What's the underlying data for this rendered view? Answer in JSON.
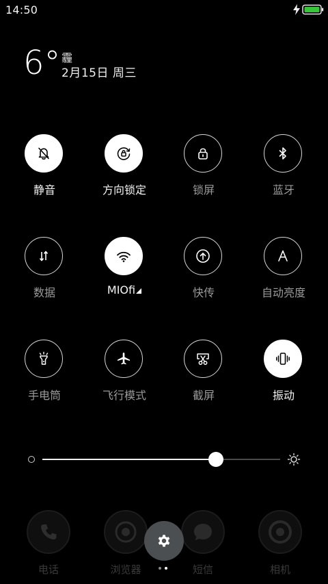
{
  "status_bar": {
    "time": "14:50",
    "icons": [
      "charging-icon",
      "battery-icon"
    ],
    "battery_color": "#39c63b"
  },
  "weather": {
    "temperature": "6°",
    "condition": "霾",
    "date": "2月15日 周三"
  },
  "toggles": [
    {
      "label": "静音",
      "icon": "silent-bell-icon",
      "on": true
    },
    {
      "label": "方向锁定",
      "icon": "rotation-lock-icon",
      "on": true
    },
    {
      "label": "锁屏",
      "icon": "lock-icon",
      "on": false
    },
    {
      "label": "蓝牙",
      "icon": "bluetooth-icon",
      "on": false
    },
    {
      "label": "数据",
      "icon": "mobile-data-icon",
      "on": false
    },
    {
      "label": "MIOfi",
      "icon": "wifi-icon",
      "on": true
    },
    {
      "label": "快传",
      "icon": "share-upload-icon",
      "on": false
    },
    {
      "label": "自动亮度",
      "icon": "auto-brightness-icon",
      "on": false
    },
    {
      "label": "手电筒",
      "icon": "flashlight-icon",
      "on": false
    },
    {
      "label": "飞行模式",
      "icon": "airplane-icon",
      "on": false
    },
    {
      "label": "截屏",
      "icon": "screenshot-scissors-icon",
      "on": false
    },
    {
      "label": "振动",
      "icon": "vibrate-icon",
      "on": true
    }
  ],
  "brightness": {
    "level": 0.73,
    "min_icon": "brightness-low-icon",
    "max_icon": "brightness-high-icon"
  },
  "dock": {
    "apps": [
      {
        "label": "电话",
        "icon": "phone-icon"
      },
      {
        "label": "浏览器",
        "icon": "browser-icon"
      },
      {
        "label": "短信",
        "icon": "message-icon"
      },
      {
        "label": "相机",
        "icon": "camera-icon"
      }
    ],
    "settings_icon": "gear-icon",
    "page_indicator": {
      "count": 2,
      "active": 1
    }
  }
}
